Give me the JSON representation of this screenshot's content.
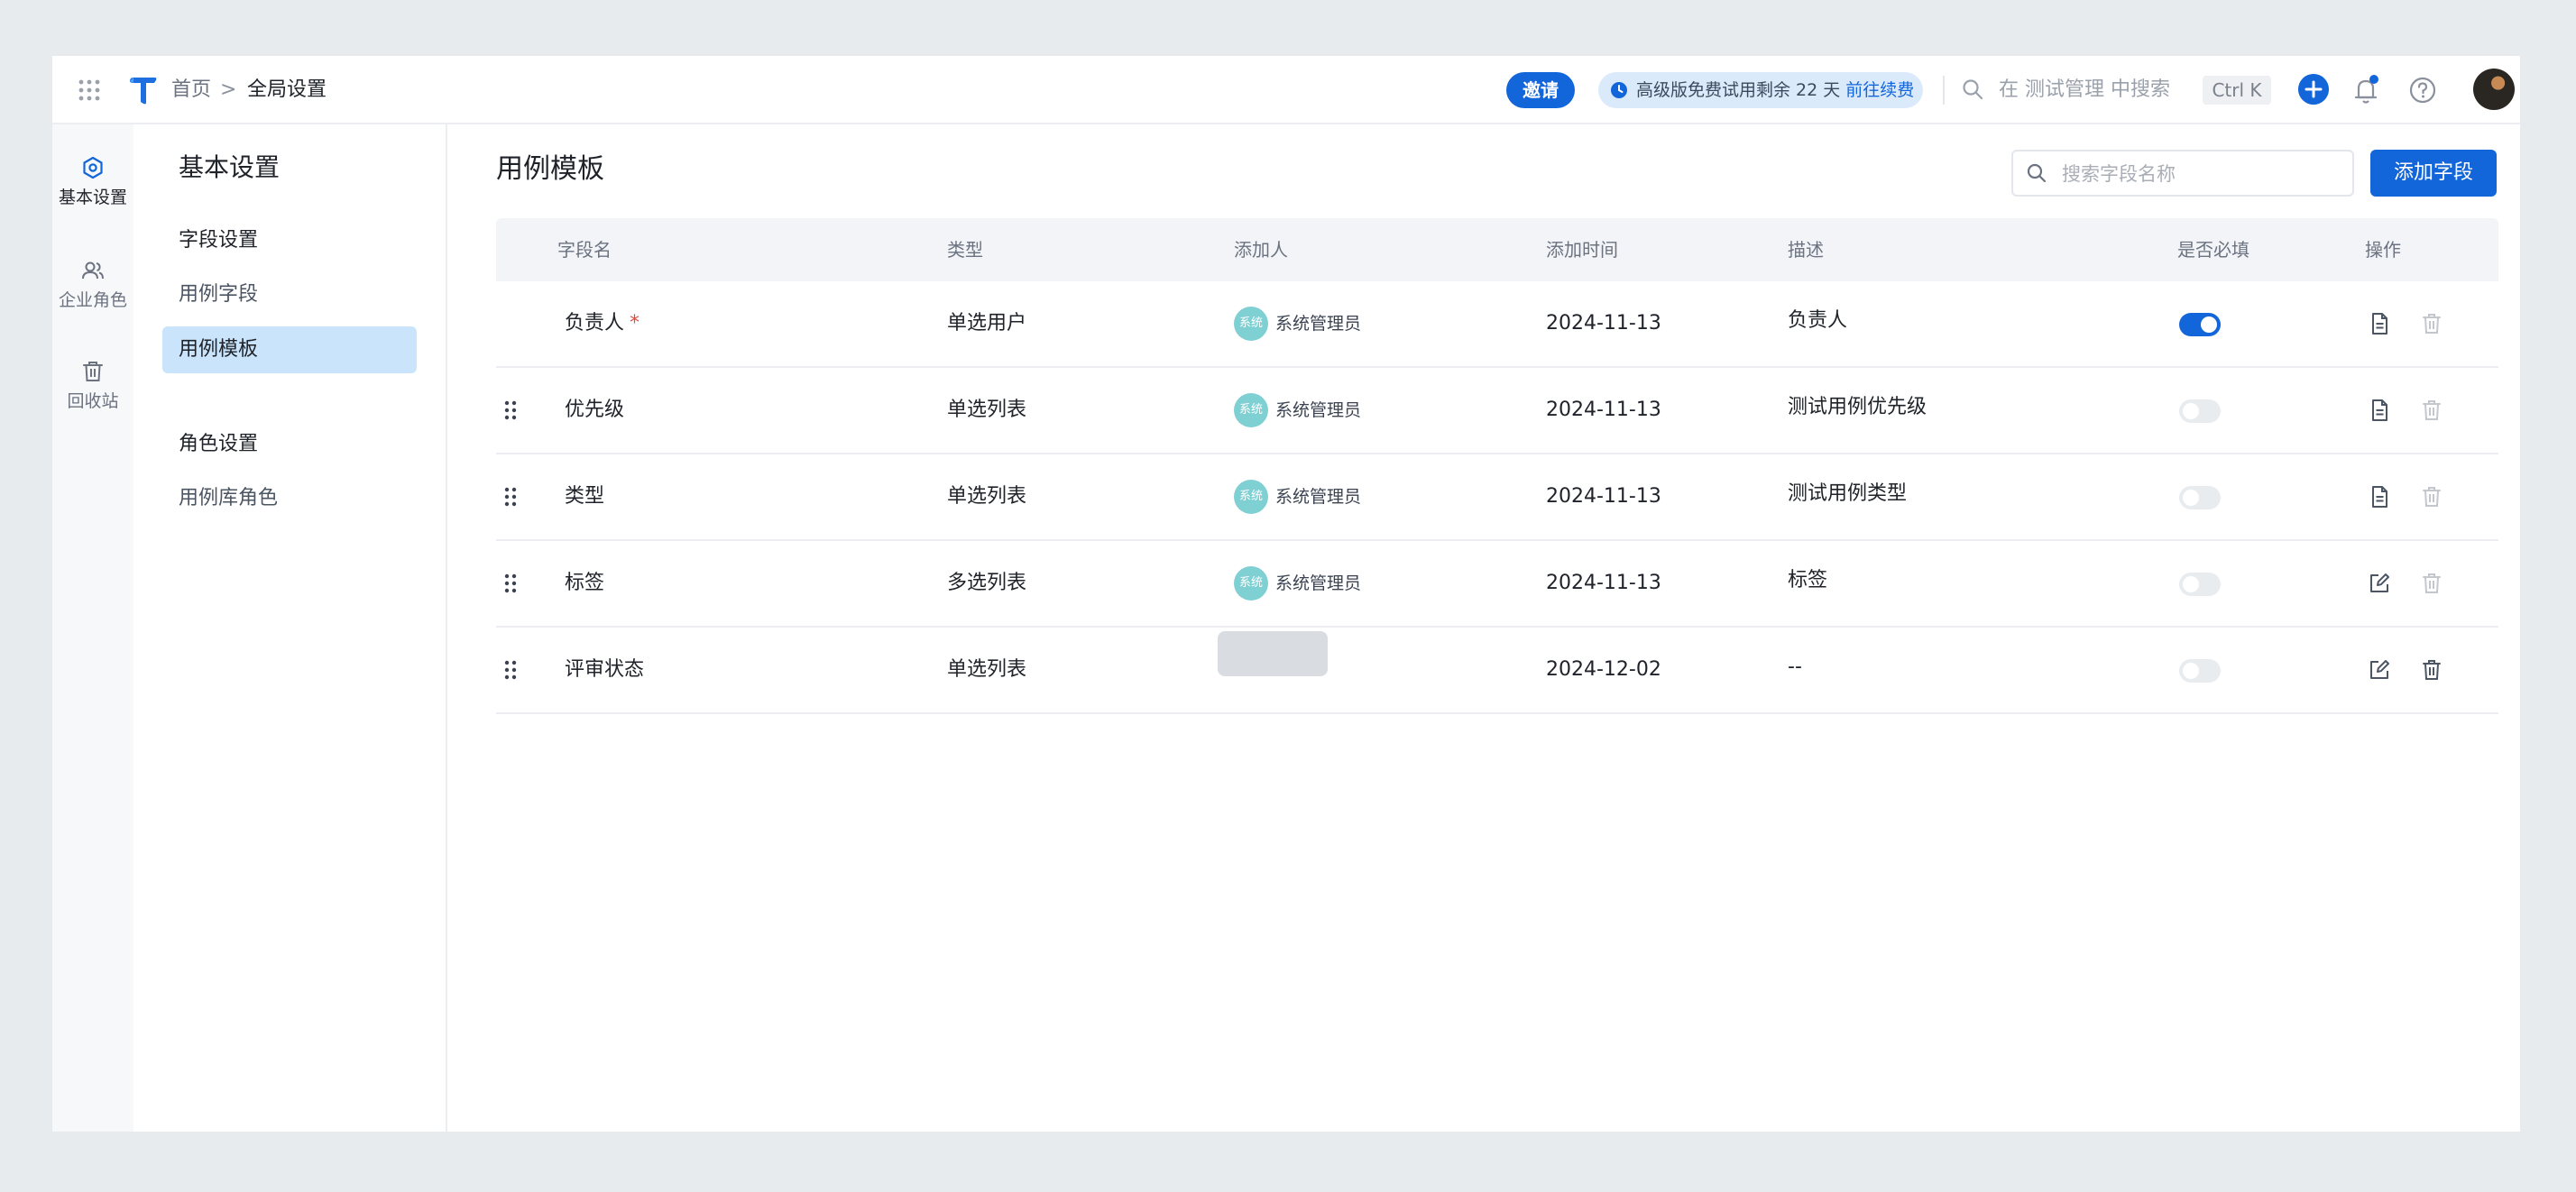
{
  "topbar": {
    "breadcrumb_home": "首页",
    "breadcrumb_sep": ">",
    "breadcrumb_current": "全局设置",
    "invite_label": "邀请",
    "trial_text": "高级版免费试用剩余 22 天 ",
    "trial_link": "前往续费",
    "search_placeholder": "在 测试管理 中搜索",
    "shortcut": "Ctrl K"
  },
  "rail": {
    "items": [
      {
        "label": "基本设置",
        "icon": "settings-hexagon-icon",
        "active": true
      },
      {
        "label": "企业角色",
        "icon": "users-icon",
        "active": false
      },
      {
        "label": "回收站",
        "icon": "trash-icon",
        "active": false
      }
    ]
  },
  "menu": {
    "title": "基本设置",
    "group1": "字段设置",
    "item1": "用例字段",
    "item2": "用例模板",
    "group2": "角色设置",
    "item3": "用例库角色"
  },
  "main": {
    "title": "用例模板",
    "search_placeholder": "搜索字段名称",
    "add_button": "添加字段"
  },
  "table": {
    "headers": {
      "name": "字段名",
      "type": "类型",
      "adder": "添加人",
      "time": "添加时间",
      "desc": "描述",
      "required": "是否必填",
      "ops": "操作"
    },
    "rows": [
      {
        "name": "负责人",
        "required_mark": "*",
        "type": "单选用户",
        "avatar": "系统",
        "adder": "系统管理员",
        "time": "2024-11-13",
        "desc": "负责人",
        "required": true,
        "draggable": false,
        "op_icon": "document-icon",
        "delete_enabled": false
      },
      {
        "name": "优先级",
        "required_mark": "",
        "type": "单选列表",
        "avatar": "系统",
        "adder": "系统管理员",
        "time": "2024-11-13",
        "desc": "测试用例优先级",
        "required": false,
        "draggable": true,
        "op_icon": "document-icon",
        "delete_enabled": false
      },
      {
        "name": "类型",
        "required_mark": "",
        "type": "单选列表",
        "avatar": "系统",
        "adder": "系统管理员",
        "time": "2024-11-13",
        "desc": "测试用例类型",
        "required": false,
        "draggable": true,
        "op_icon": "document-icon",
        "delete_enabled": false
      },
      {
        "name": "标签",
        "required_mark": "",
        "type": "多选列表",
        "avatar": "系统",
        "adder": "系统管理员",
        "time": "2024-11-13",
        "desc": "标签",
        "required": false,
        "draggable": true,
        "op_icon": "edit-icon",
        "delete_enabled": false
      },
      {
        "name": "评审状态",
        "required_mark": "",
        "type": "单选列表",
        "avatar": "",
        "adder": "",
        "time": "2024-12-02",
        "desc": "--",
        "required": false,
        "draggable": true,
        "op_icon": "edit-icon",
        "delete_enabled": true
      }
    ]
  },
  "colors": {
    "accent": "#1366d9",
    "active_menu_bg": "#c9e4fb",
    "header_bg": "#f2f4f7",
    "required_mark": "#e5483a"
  }
}
